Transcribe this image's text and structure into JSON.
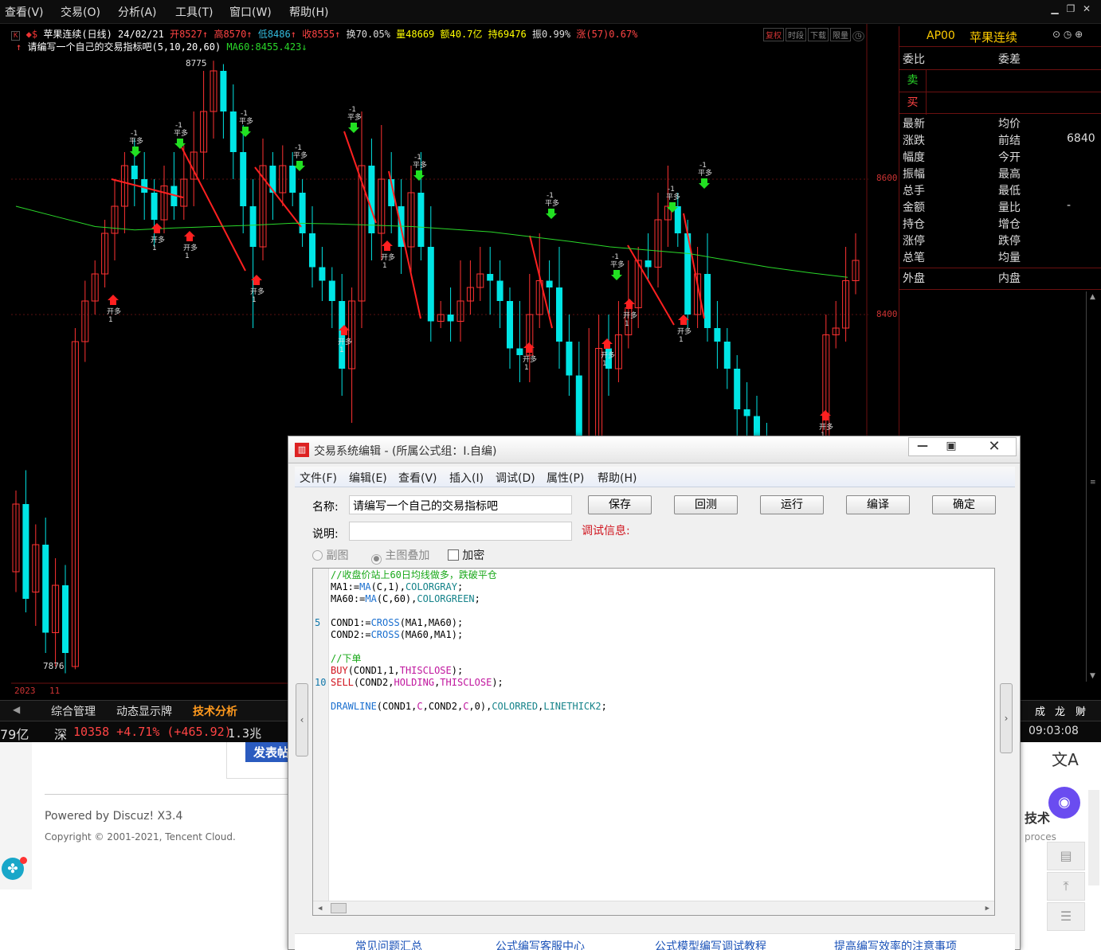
{
  "menubar": {
    "items": [
      "查看(V)",
      "交易(O)",
      "分析(A)",
      "工具(T)",
      "窗口(W)",
      "帮助(H)"
    ]
  },
  "chart": {
    "symbol_title": "苹果连续(日线) 24/02/21",
    "open": "开8527",
    "high": "高8570",
    "low": "低8486",
    "close": "收8555",
    "turnover": "换70.05%",
    "volume": "量48669",
    "amount": "额40.7亿",
    "position": "持69476",
    "amplitude": "振0.99%",
    "change": "涨(57)0.67%",
    "indicator_line": "请编写一个自己的交易指标吧(5,10,20,60)",
    "ma60_label": "MA60:8455.423",
    "btn_labels": [
      "复权",
      "时段",
      "下载",
      "限量"
    ],
    "price_high_label": "8775",
    "price_low_label": "7876",
    "axis_labels": [
      "8600",
      "8400"
    ],
    "year_label": "2023",
    "month_label": "11",
    "signal_open_long": "开多",
    "signal_close_short": "平多",
    "signal_qty_pos": "1",
    "signal_qty_neg": "-1"
  },
  "chart_data": {
    "type": "candlestick",
    "ma60": [
      8560,
      8545,
      8530,
      8525,
      8528,
      8530,
      8532,
      8535,
      8534,
      8532,
      8530,
      8526,
      8522,
      8515,
      8508,
      8500,
      8495,
      8490,
      8480,
      8470,
      8462,
      8455
    ]
  },
  "rpanel": {
    "code": "AP00",
    "name": "苹果连续",
    "rows1": [
      [
        "委比",
        "委差"
      ]
    ],
    "sell": "卖",
    "buy": "买",
    "rows2": [
      [
        "最新",
        "均价",
        ""
      ],
      [
        "涨跌",
        "前结",
        "6840"
      ],
      [
        "幅度",
        "今开",
        ""
      ],
      [
        "振幅",
        "最高",
        ""
      ],
      [
        "总手",
        "最低",
        ""
      ],
      [
        "金额",
        "量比",
        "-"
      ],
      [
        "持仓",
        "增仓",
        ""
      ],
      [
        "涨停",
        "跌停",
        ""
      ],
      [
        "总笔",
        "均量",
        ""
      ]
    ],
    "outer": "外盘",
    "inner": "内盘"
  },
  "tabs": [
    "综合管理",
    "动态显示牌",
    "技术分析"
  ],
  "tab_right": [
    "成",
    "龙",
    "财"
  ],
  "status": {
    "left_value": "79亿",
    "market": "深",
    "index": "10358 +4.71% (+465.92)",
    "volume": "1.3兆",
    "time": "09:03:08"
  },
  "web": {
    "post_button": "发表帖",
    "powered": "Powered by Discuz! X3.4",
    "copyright": "Copyright © 2001-2021, Tencent Cloud.",
    "right_text1": "技术",
    "right_text2": "proces"
  },
  "dialog": {
    "title": "交易系统编辑 - (所属公式组：I.自编)",
    "menu": [
      "文件(F)",
      "编辑(E)",
      "查看(V)",
      "插入(I)",
      "调试(D)",
      "属性(P)",
      "帮助(H)"
    ],
    "name_label": "名称:",
    "name_value": "请编写一个自己的交易指标吧",
    "desc_label": "说明:",
    "desc_value": "",
    "buttons": [
      "保存",
      "回测",
      "运行",
      "编译",
      "确定"
    ],
    "debug_label": "调试信息:",
    "opt_sub": "副图",
    "opt_main": "主图叠加",
    "opt_encrypt": "加密",
    "line_numbers": [
      "5",
      "10"
    ],
    "code": {
      "l1": "//收盘价站上60日均线做多，跌破平仓",
      "l2a": "MA1:=",
      "l2b": "MA",
      "l2c": "(C,1),",
      "l2d": "COLORGRAY",
      "l2e": ";",
      "l3a": "MA60:=",
      "l3b": "MA",
      "l3c": "(C,60),",
      "l3d": "COLORGREEN",
      "l3e": ";",
      "l5a": "COND1:=",
      "l5b": "CROSS",
      "l5c": "(MA1,MA60);",
      "l6a": "COND2:=",
      "l6b": "CROSS",
      "l6c": "(MA60,MA1);",
      "l8": "//下单",
      "l9a": "BUY",
      "l9b": "(COND1,1,",
      "l9c": "THISCLOSE",
      "l9d": ");",
      "l10a": "SELL",
      "l10b": "(COND2,",
      "l10c": "HOLDING",
      "l10d": ",",
      "l10e": "THISCLOSE",
      "l10f": ");",
      "l12a": "DRAWLINE",
      "l12b": "(COND1,",
      "l12c": "C",
      "l12d": ",COND2,",
      "l12e": "C",
      "l12f": ",0),",
      "l12g": "COLORRED",
      "l12h": ",",
      "l12i": "LINETHICK2",
      "l12j": ";"
    },
    "links": [
      "常见问题汇总",
      "公式编写客服中心",
      "公式模型编写调试教程",
      "提高编写效率的注意事项"
    ]
  }
}
